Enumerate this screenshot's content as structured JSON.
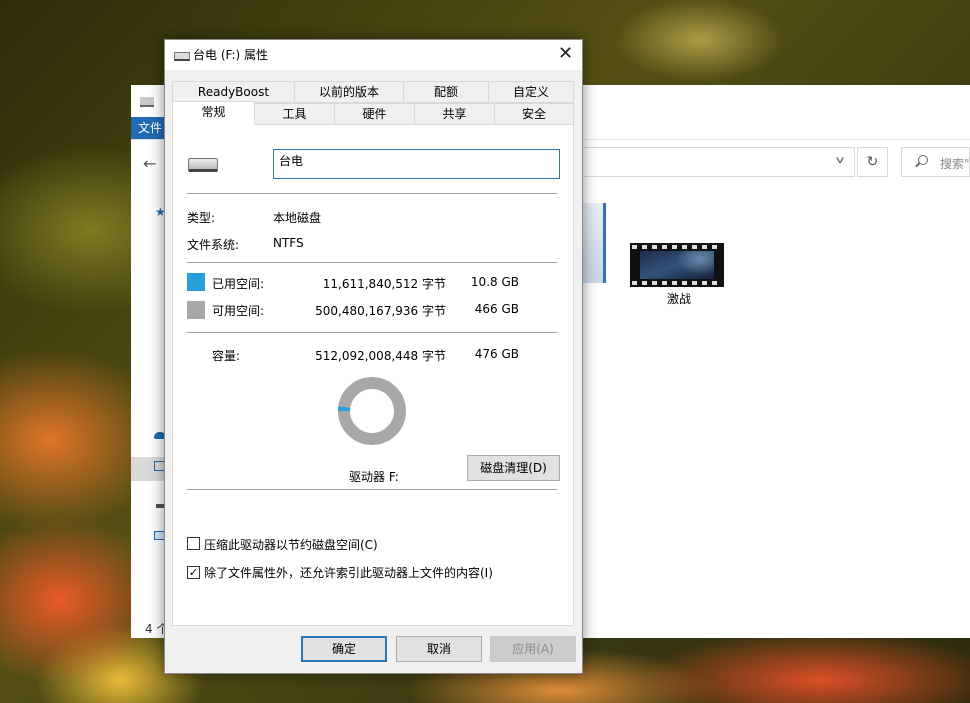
{
  "explorer": {
    "ribbon_file_tab": "文件",
    "search_placeholder": "搜索\"",
    "status_count": "4 个",
    "file_items": [
      {
        "name": "激战",
        "icon": "video-file-icon"
      }
    ]
  },
  "dialog": {
    "title": "台电 (F:) 属性",
    "tabs_row1": [
      "ReadyBoost",
      "以前的版本",
      "配额",
      "自定义"
    ],
    "tabs_row2": [
      "常规",
      "工具",
      "硬件",
      "共享",
      "安全"
    ],
    "active_tab": "常规",
    "volume_name": "台电",
    "type_label": "类型:",
    "type_value": "本地磁盘",
    "fs_label": "文件系统:",
    "fs_value": "NTFS",
    "used": {
      "label": "已用空间:",
      "bytes": "11,611,840,512 字节",
      "size": "10.8 GB",
      "color": "#26a0da"
    },
    "free": {
      "label": "可用空间:",
      "bytes": "500,480,167,936 字节",
      "size": "466 GB",
      "color": "#a8a8a8"
    },
    "capacity": {
      "label": "容量:",
      "bytes": "512,092,008,448 字节",
      "size": "476 GB"
    },
    "used_fraction": 0.0227,
    "drive_label": "驱动器 F:",
    "cleanup_button": "磁盘清理(D)",
    "compress_checkbox": {
      "label": "压缩此驱动器以节约磁盘空间(C)",
      "checked": false
    },
    "index_checkbox": {
      "label": "除了文件属性外，还允许索引此驱动器上文件的内容(I)",
      "checked": true
    },
    "ok_button": "确定",
    "cancel_button": "取消",
    "apply_button": "应用(A)"
  }
}
